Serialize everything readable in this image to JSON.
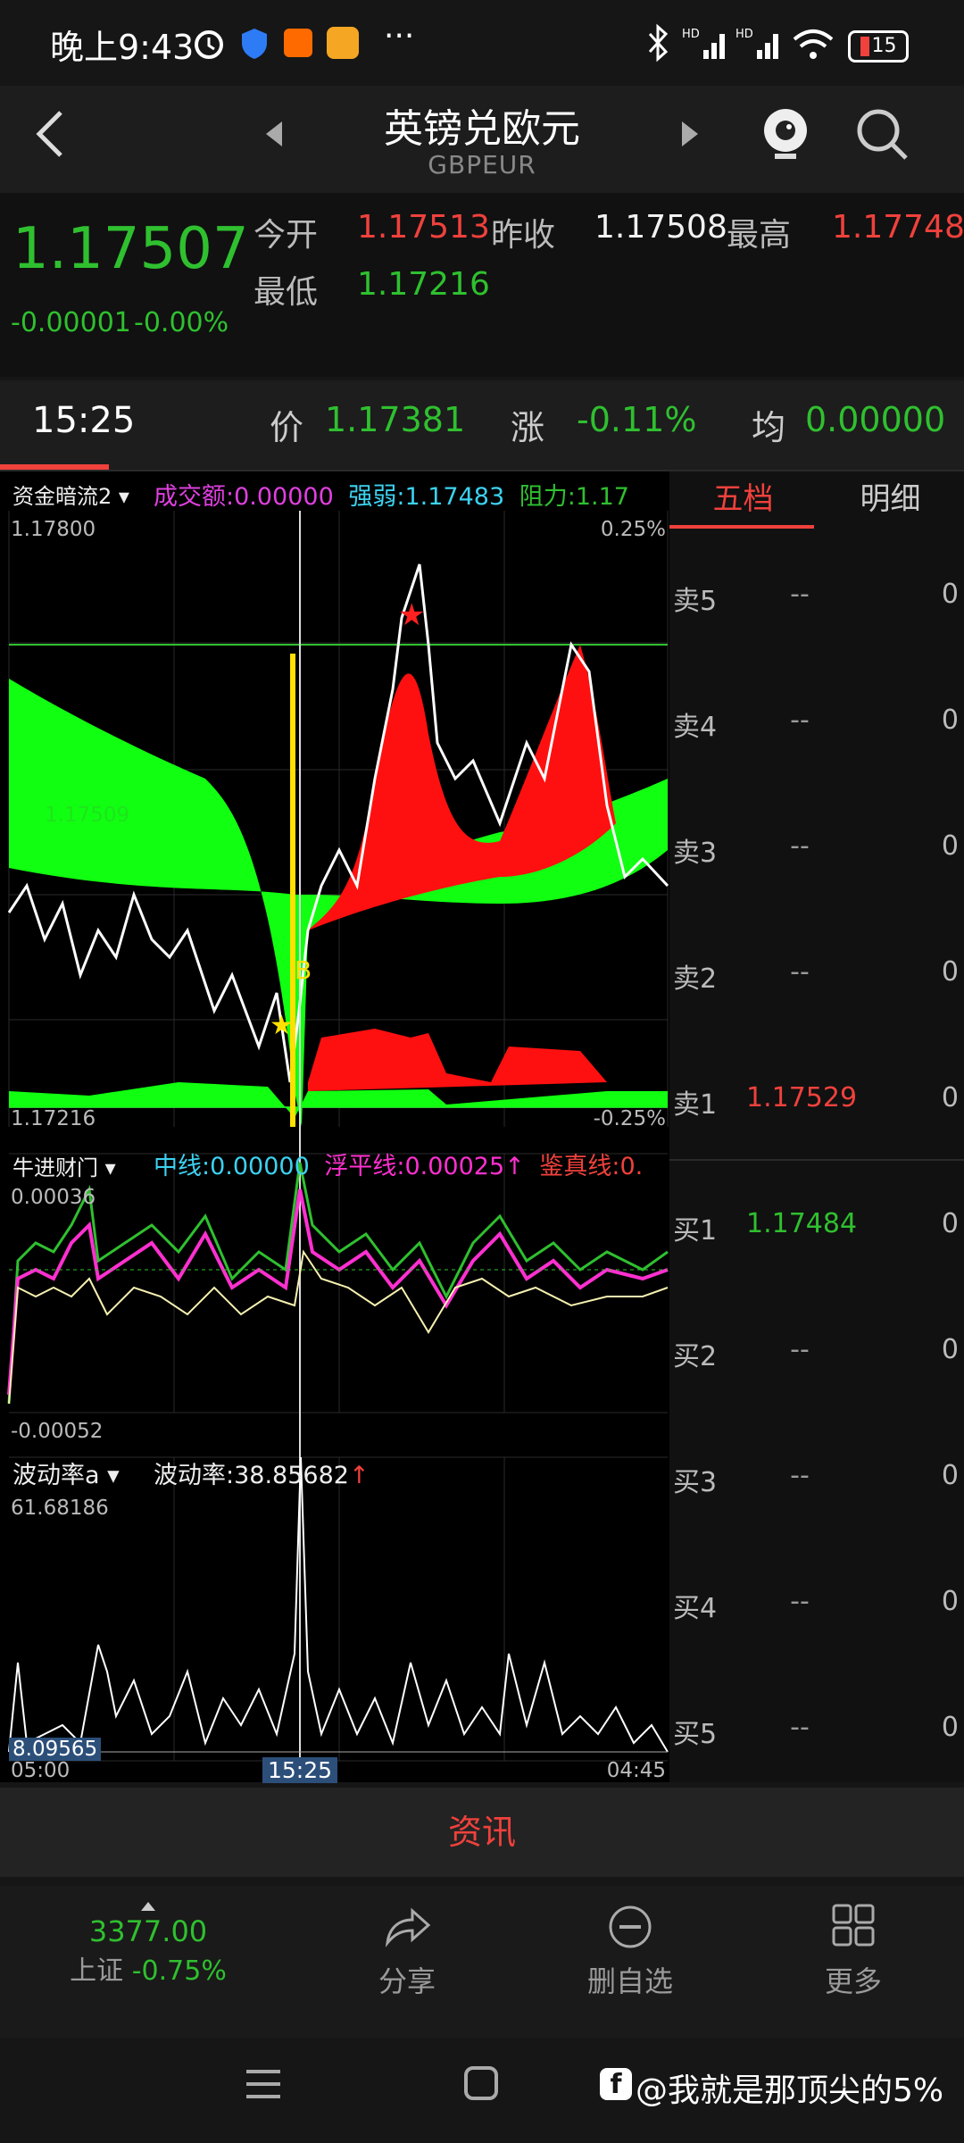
{
  "status": {
    "time": "晚上9:43",
    "battery": "15"
  },
  "nav": {
    "title": "英镑兑欧元",
    "subtitle": "GBPEUR"
  },
  "quote": {
    "price": "1.17507",
    "change": "-0.00001",
    "change_pct": "-0.00%",
    "open_label": "今开",
    "open": "1.17513",
    "prev_close_label": "昨收",
    "prev_close": "1.17508",
    "high_label": "最高",
    "high": "1.17748",
    "low_label": "最低",
    "low": "1.17216"
  },
  "crosshair": {
    "time": "15:25",
    "price_label": "价",
    "price": "1.17381",
    "change_label": "涨",
    "change": "-0.11%",
    "avg_label": "均",
    "avg": "0.00000"
  },
  "panel1": {
    "indicator": "资金暗流2",
    "volume_label": "成交额:",
    "volume": "0.00000",
    "strength_label": "强弱:",
    "strength": "1.17483",
    "resistance_label": "阻力:",
    "resistance": "1.17",
    "y_top": "1.17800",
    "y_bottom": "1.17216",
    "pct_top": "0.25%",
    "pct_bottom": "-0.25%",
    "mid_label": "1.17509",
    "buy_marker": "B"
  },
  "panel2": {
    "indicator": "牛进财门",
    "mid_label": "中线:",
    "mid": "0.00000",
    "float_label": "浮平线:",
    "float": "0.00025↑",
    "true_label": "鉴真线:",
    "true": "0.",
    "y_top": "0.00036",
    "y_bottom": "-0.00052"
  },
  "panel3": {
    "indicator": "波动率a",
    "vol_label": "波动率:",
    "vol": "38.85682",
    "vol_arrow": "↑",
    "y_top": "61.68186",
    "y_bottom": "8.09565",
    "x_start": "05:00",
    "x_cursor": "15:25",
    "x_end": "04:45"
  },
  "orderbook": {
    "tabs": [
      "五档",
      "明细"
    ],
    "asks": [
      {
        "label": "卖5",
        "price": "--",
        "vol": "0"
      },
      {
        "label": "卖4",
        "price": "--",
        "vol": "0"
      },
      {
        "label": "卖3",
        "price": "--",
        "vol": "0"
      },
      {
        "label": "卖2",
        "price": "--",
        "vol": "0"
      },
      {
        "label": "卖1",
        "price": "1.17529",
        "vol": "0"
      }
    ],
    "bids": [
      {
        "label": "买1",
        "price": "1.17484",
        "vol": "0"
      },
      {
        "label": "买2",
        "price": "--",
        "vol": "0"
      },
      {
        "label": "买3",
        "price": "--",
        "vol": "0"
      },
      {
        "label": "买4",
        "price": "--",
        "vol": "0"
      },
      {
        "label": "买5",
        "price": "--",
        "vol": "0"
      }
    ]
  },
  "news_label": "资讯",
  "bottom": {
    "index_value": "3377.00",
    "index_name": "上证",
    "index_change": "-0.75%",
    "share": "分享",
    "remove": "删自选",
    "more": "更多"
  },
  "watermark": "@我就是那顶尖的5%",
  "colors": {
    "up": "#f0413c",
    "down": "#2fc02f",
    "accent": "#f0413c"
  }
}
